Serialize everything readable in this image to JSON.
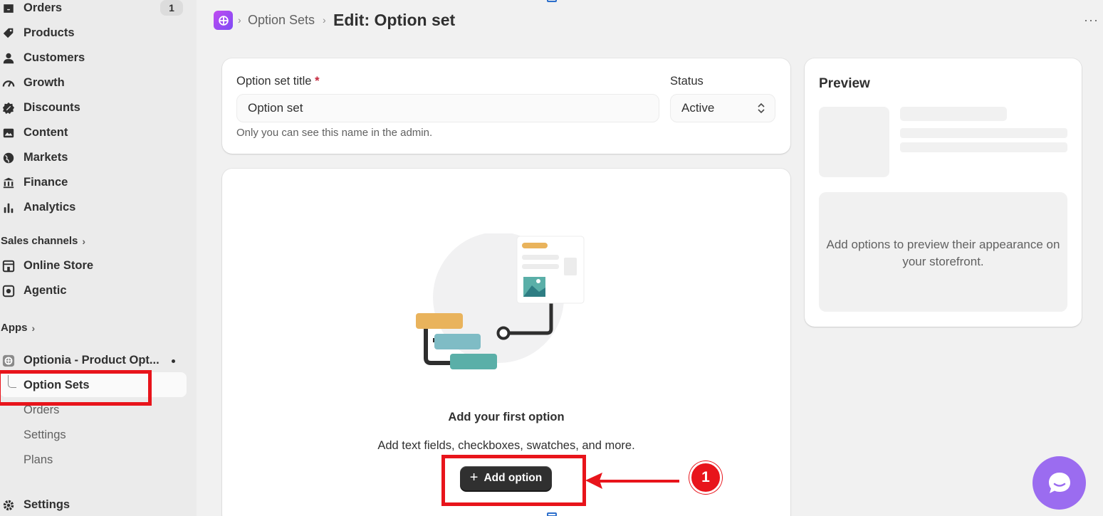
{
  "sidebar": {
    "items": [
      {
        "label": "Orders",
        "icon": "inbox-icon",
        "badge": "1"
      },
      {
        "label": "Products",
        "icon": "tag-icon"
      },
      {
        "label": "Customers",
        "icon": "person-icon"
      },
      {
        "label": "Growth",
        "icon": "gauge-icon"
      },
      {
        "label": "Discounts",
        "icon": "discount-icon"
      },
      {
        "label": "Content",
        "icon": "image-icon"
      },
      {
        "label": "Markets",
        "icon": "globe-icon"
      },
      {
        "label": "Finance",
        "icon": "bank-icon"
      },
      {
        "label": "Analytics",
        "icon": "bar-chart-icon"
      }
    ],
    "sales_channels_label": "Sales channels",
    "channels": [
      {
        "label": "Online Store",
        "icon": "store-icon"
      },
      {
        "label": "Agentic",
        "icon": "agentic-icon"
      }
    ],
    "apps_label": "Apps",
    "app": {
      "name": "Optionia - Product Opt...",
      "subitems": [
        "Option Sets",
        "Orders",
        "Settings",
        "Plans"
      ]
    },
    "settings_label": "Settings"
  },
  "header": {
    "breadcrumb": "Option Sets",
    "title": "Edit: Option set",
    "more": "···"
  },
  "form": {
    "title_label": "Option set title",
    "required_mark": "*",
    "title_value": "Option set",
    "title_help": "Only you can see this name in the admin.",
    "status_label": "Status",
    "status_value": "Active"
  },
  "empty_state": {
    "heading": "Add your first option",
    "description": "Add text fields, checkboxes, swatches, and more.",
    "button_label": "Add option"
  },
  "preview": {
    "title": "Preview",
    "message": "Add options to preview their appearance on your storefront."
  },
  "annotation": {
    "step_number": "1"
  },
  "colors": {
    "accent_red": "#e8141b",
    "button_dark": "#303030",
    "chat_purple": "#9b6cf0"
  }
}
